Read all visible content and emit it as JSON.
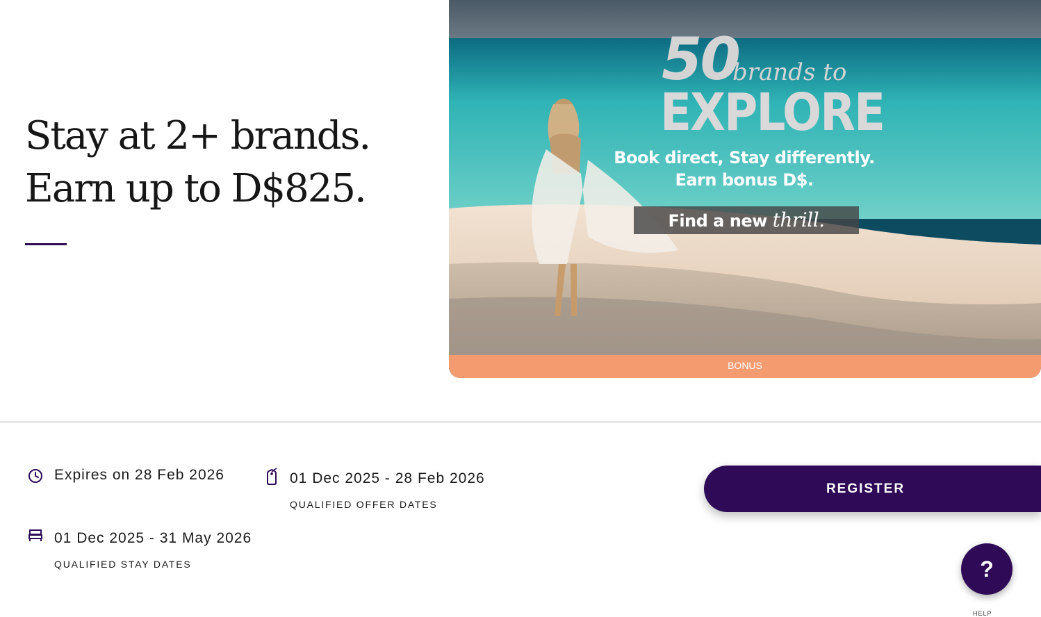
{
  "offer": {
    "headline": "Stay at 2+ brands. Earn up to D$825."
  },
  "hero": {
    "promo_number": "50",
    "promo_brands_text": "brands to",
    "promo_explore_text": "EXPLORE",
    "promo_line1": "Book direct, Stay differently.",
    "promo_line2": "Earn bonus D$.",
    "promo_cta_prefix": "Find a new",
    "promo_cta_script": "thrill.",
    "badge": "BONUS",
    "colors": {
      "badge_bg": "#f59b70",
      "sea": "#2fb3b5",
      "sand": "#ead7c6"
    }
  },
  "details": {
    "expires": {
      "icon": "clock-icon",
      "value": "Expires on 28 Feb 2026"
    },
    "offer_dates": {
      "icon": "tag-icon",
      "value": "01 Dec 2025 - 28 Feb 2026",
      "caption": "QUALIFIED OFFER DATES"
    },
    "stay_dates": {
      "icon": "bed-icon",
      "value": "01 Dec 2025 - 31 May 2026",
      "caption": "QUALIFIED STAY DATES"
    }
  },
  "actions": {
    "register_label": "REGISTER",
    "help_symbol": "?",
    "help_label": "HELP"
  },
  "theme": {
    "accent": "#2f0b57"
  }
}
